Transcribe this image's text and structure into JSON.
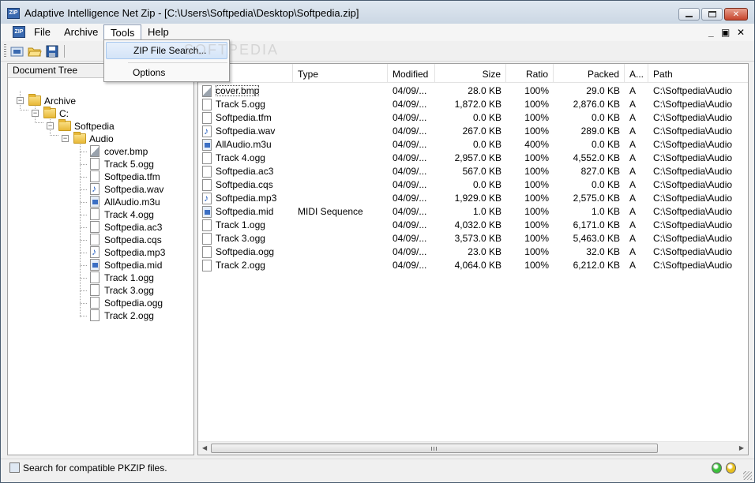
{
  "window": {
    "title": "Adaptive Intelligence Net Zip - [C:\\Users\\Softpedia\\Desktop\\Softpedia.zip]",
    "app_icon": "ZIP"
  },
  "menu": {
    "items": [
      "File",
      "Archive",
      "Tools",
      "Help"
    ],
    "open_menu": "Tools",
    "mdi_controls": [
      "_",
      "▣",
      "✕"
    ]
  },
  "toolbar": {
    "buttons": [
      "new-archive-icon",
      "open-folder-icon",
      "save-icon"
    ]
  },
  "tools_dropdown": {
    "items": [
      "ZIP File Search...",
      "Options"
    ],
    "highlighted": "ZIP File Search..."
  },
  "watermark": "SOFTPEDIA",
  "tree": {
    "header": "Document Tree",
    "root": "Archive",
    "drive": "C:",
    "folder1": "Softpedia",
    "folder2": "Audio",
    "files": [
      {
        "name": "cover.bmp",
        "icon": "bmp"
      },
      {
        "name": "Track 5.ogg",
        "icon": "file"
      },
      {
        "name": "Softpedia.tfm",
        "icon": "file"
      },
      {
        "name": "Softpedia.wav",
        "icon": "note"
      },
      {
        "name": "AllAudio.m3u",
        "icon": "m3u"
      },
      {
        "name": "Track 4.ogg",
        "icon": "file"
      },
      {
        "name": "Softpedia.ac3",
        "icon": "file"
      },
      {
        "name": "Softpedia.cqs",
        "icon": "file"
      },
      {
        "name": "Softpedia.mp3",
        "icon": "note"
      },
      {
        "name": "Softpedia.mid",
        "icon": "mid"
      },
      {
        "name": "Track 1.ogg",
        "icon": "file"
      },
      {
        "name": "Track 3.ogg",
        "icon": "file"
      },
      {
        "name": "Softpedia.ogg",
        "icon": "file"
      },
      {
        "name": "Track 2.ogg",
        "icon": "file"
      }
    ]
  },
  "list": {
    "columns": [
      "Type",
      "Modified",
      "Size",
      "Ratio",
      "Packed",
      "A...",
      "Path"
    ],
    "rows": [
      {
        "name": "cover.bmp",
        "icon": "bmp",
        "type": "",
        "modified": "04/09/...",
        "size": "28.0 KB",
        "ratio": "100%",
        "packed": "29.0 KB",
        "attr": "A",
        "path": "C:\\Softpedia\\Audio"
      },
      {
        "name": "Track 5.ogg",
        "icon": "file",
        "type": "",
        "modified": "04/09/...",
        "size": "1,872.0 KB",
        "ratio": "100%",
        "packed": "2,876.0 KB",
        "attr": "A",
        "path": "C:\\Softpedia\\Audio"
      },
      {
        "name": "Softpedia.tfm",
        "icon": "file",
        "type": "",
        "modified": "04/09/...",
        "size": "0.0 KB",
        "ratio": "100%",
        "packed": "0.0 KB",
        "attr": "A",
        "path": "C:\\Softpedia\\Audio"
      },
      {
        "name": "Softpedia.wav",
        "icon": "note",
        "type": "",
        "modified": "04/09/...",
        "size": "267.0 KB",
        "ratio": "100%",
        "packed": "289.0 KB",
        "attr": "A",
        "path": "C:\\Softpedia\\Audio"
      },
      {
        "name": "AllAudio.m3u",
        "icon": "m3u",
        "type": "",
        "modified": "04/09/...",
        "size": "0.0 KB",
        "ratio": "400%",
        "packed": "0.0 KB",
        "attr": "A",
        "path": "C:\\Softpedia\\Audio"
      },
      {
        "name": "Track 4.ogg",
        "icon": "file",
        "type": "",
        "modified": "04/09/...",
        "size": "2,957.0 KB",
        "ratio": "100%",
        "packed": "4,552.0 KB",
        "attr": "A",
        "path": "C:\\Softpedia\\Audio"
      },
      {
        "name": "Softpedia.ac3",
        "icon": "file",
        "type": "",
        "modified": "04/09/...",
        "size": "567.0 KB",
        "ratio": "100%",
        "packed": "827.0 KB",
        "attr": "A",
        "path": "C:\\Softpedia\\Audio"
      },
      {
        "name": "Softpedia.cqs",
        "icon": "file",
        "type": "",
        "modified": "04/09/...",
        "size": "0.0 KB",
        "ratio": "100%",
        "packed": "0.0 KB",
        "attr": "A",
        "path": "C:\\Softpedia\\Audio"
      },
      {
        "name": "Softpedia.mp3",
        "icon": "note",
        "type": "",
        "modified": "04/09/...",
        "size": "1,929.0 KB",
        "ratio": "100%",
        "packed": "2,575.0 KB",
        "attr": "A",
        "path": "C:\\Softpedia\\Audio"
      },
      {
        "name": "Softpedia.mid",
        "icon": "mid",
        "type": "MIDI Sequence",
        "modified": "04/09/...",
        "size": "1.0 KB",
        "ratio": "100%",
        "packed": "1.0 KB",
        "attr": "A",
        "path": "C:\\Softpedia\\Audio"
      },
      {
        "name": "Track 1.ogg",
        "icon": "file",
        "type": "",
        "modified": "04/09/...",
        "size": "4,032.0 KB",
        "ratio": "100%",
        "packed": "6,171.0 KB",
        "attr": "A",
        "path": "C:\\Softpedia\\Audio"
      },
      {
        "name": "Track 3.ogg",
        "icon": "file",
        "type": "",
        "modified": "04/09/...",
        "size": "3,573.0 KB",
        "ratio": "100%",
        "packed": "5,463.0 KB",
        "attr": "A",
        "path": "C:\\Softpedia\\Audio"
      },
      {
        "name": "Softpedia.ogg",
        "icon": "file",
        "type": "",
        "modified": "04/09/...",
        "size": "23.0 KB",
        "ratio": "100%",
        "packed": "32.0 KB",
        "attr": "A",
        "path": "C:\\Softpedia\\Audio"
      },
      {
        "name": "Track 2.ogg",
        "icon": "file",
        "type": "",
        "modified": "04/09/...",
        "size": "4,064.0 KB",
        "ratio": "100%",
        "packed": "6,212.0 KB",
        "attr": "A",
        "path": "C:\\Softpedia\\Audio"
      }
    ]
  },
  "statusbar": {
    "text": "Search for compatible PKZIP files.",
    "indicators": [
      {
        "name": "green-indicator-icon",
        "color": "#3cbf3c"
      },
      {
        "name": "yellow-indicator-icon",
        "color": "#e8c020"
      }
    ]
  }
}
